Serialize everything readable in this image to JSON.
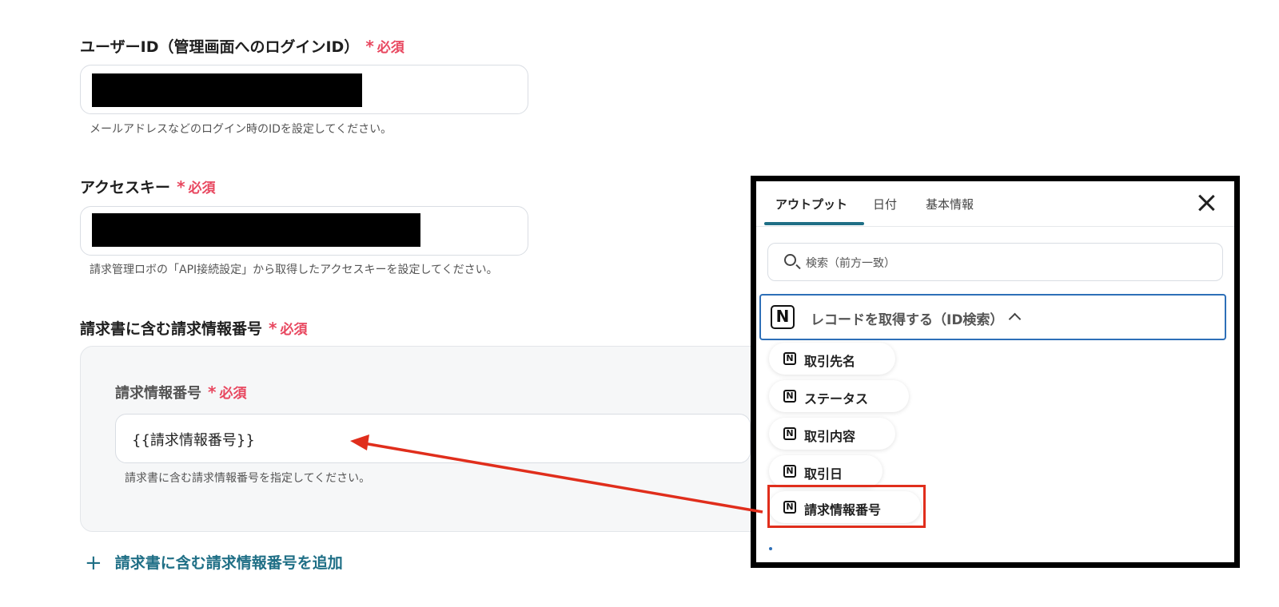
{
  "fields": {
    "user_id": {
      "label": "ユーザーID（管理画面へのログインID）",
      "required": "必須",
      "hint": "メールアドレスなどのログイン時のIDを設定してください。"
    },
    "access_key": {
      "label": "アクセスキー",
      "required": "必須",
      "hint": "請求管理ロボの「API接続設定」から取得したアクセスキーを設定してください。"
    },
    "invoice_group": {
      "label": "請求書に含む請求情報番号",
      "required": "必須"
    },
    "invoice_number": {
      "label": "請求情報番号",
      "required": "必須",
      "value": "{{請求情報番号}}",
      "hint": "請求書に含む請求情報番号を指定してください。"
    },
    "add_link": "請求書に含む請求情報番号を追加"
  },
  "required_star": "*",
  "add_icon": "+",
  "panel": {
    "tabs": [
      "アウトプット",
      "日付",
      "基本情報"
    ],
    "active_tab": 0,
    "search_placeholder": "検索（前方一致）",
    "section_title": "レコードを取得する（ID検索）",
    "section_icon": "N",
    "items": [
      "取引先名",
      "ステータス",
      "取引内容",
      "取引日",
      "請求情報番号"
    ],
    "highlighted_item": "請求情報番号"
  },
  "colors": {
    "required": "#e8475f",
    "accent": "#1f6f86",
    "highlight": "#e02e1c",
    "section_border": "#2e6fb8"
  }
}
